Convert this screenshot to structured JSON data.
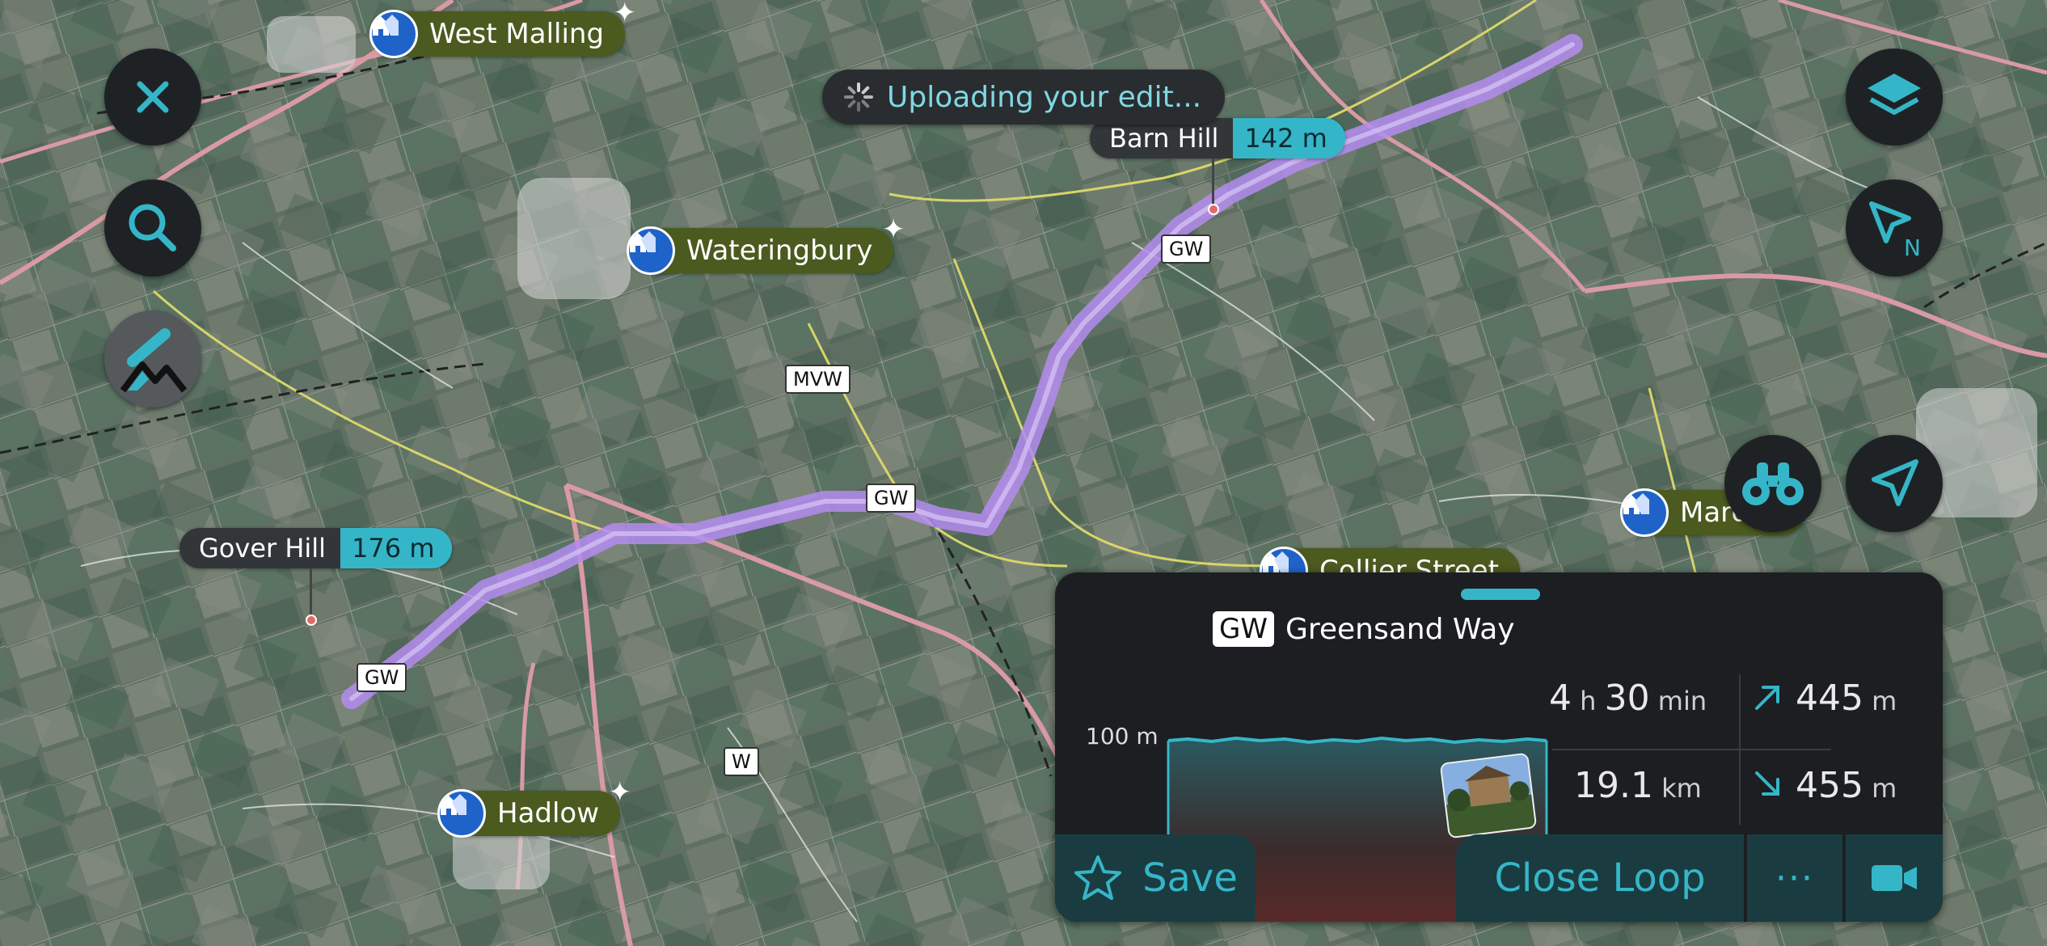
{
  "status_toast": {
    "message": "Uploading your edit..."
  },
  "controls": {
    "close": "close-icon",
    "search": "search-icon",
    "peak_view": "peak-finder-icon",
    "layers": "layers-icon",
    "compass": "north-compass-icon",
    "binoculars": "binoculars-icon",
    "location": "my-location-icon",
    "compass_letter": "N"
  },
  "places": [
    {
      "name": "West Malling"
    },
    {
      "name": "Wateringbury"
    },
    {
      "name": "Hadlow"
    },
    {
      "name": "Collier Street"
    },
    {
      "name": "Marden"
    }
  ],
  "peaks": [
    {
      "name": "Barn Hill",
      "elevation": "142 m"
    },
    {
      "name": "Gover Hill",
      "elevation": "176 m"
    }
  ],
  "route_markers": [
    "GW",
    "GW",
    "GW",
    "MVW",
    "W"
  ],
  "panel": {
    "trail_code": "GW",
    "trail_name": "Greensand Way",
    "elevation_axis": "100 m",
    "duration": {
      "h": "4",
      "h_unit": "h",
      "min": "30",
      "min_unit": "min"
    },
    "distance": {
      "value": "19.1",
      "unit": "km"
    },
    "ascent": {
      "value": "445",
      "unit": "m"
    },
    "descent": {
      "value": "455",
      "unit": "m"
    },
    "actions": {
      "save": "Save",
      "close_loop": "Close Loop",
      "more": "···"
    }
  },
  "colors": {
    "accent": "#35b6c8",
    "route": "#b48cf0",
    "panel_bg": "#1c1e21",
    "place_label_bg": "#4b5a1f",
    "place_badge": "#1f63c9"
  }
}
